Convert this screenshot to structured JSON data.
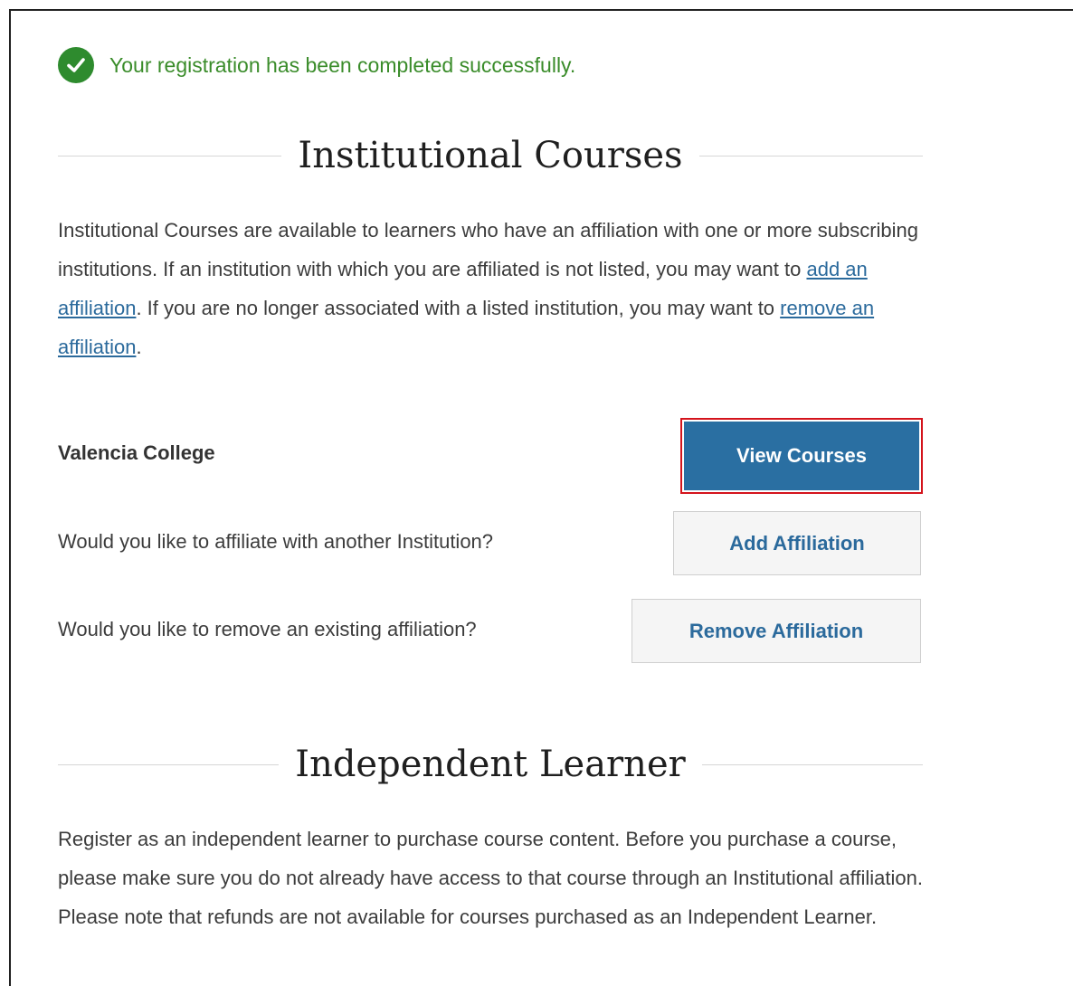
{
  "success": {
    "icon": "check-circle-icon",
    "message": "Your registration has been completed successfully."
  },
  "institutional": {
    "title": "Institutional Courses",
    "para_part1": "Institutional Courses are available to learners who have an affiliation with one or more subscribing institutions. If an institution with which you are affiliated is not listed, you may want to ",
    "link_add": "add an affiliation",
    "para_part2": ". If you are no longer associated with a listed institution, you may want to ",
    "link_remove": "remove an affiliation",
    "para_part3": ".",
    "institution_name": "Valencia College",
    "view_courses_label": "View Courses",
    "add_question": "Would you like to affiliate with another Institution?",
    "add_button_label": "Add Affiliation",
    "remove_question": "Would you like to remove an existing affiliation?",
    "remove_button_label": "Remove Affiliation"
  },
  "independent": {
    "title": "Independent Learner",
    "description": "Register as an independent learner to purchase course content. Before you purchase a course, please make sure you do not already have access to that course through an Institutional affiliation. Please note that refunds are not available for courses purchased as an Independent Learner."
  },
  "colors": {
    "success_green": "#3a8c2a",
    "primary_button": "#2a6fa2",
    "highlight_border": "#d4141c",
    "link": "#2b6a9c"
  }
}
